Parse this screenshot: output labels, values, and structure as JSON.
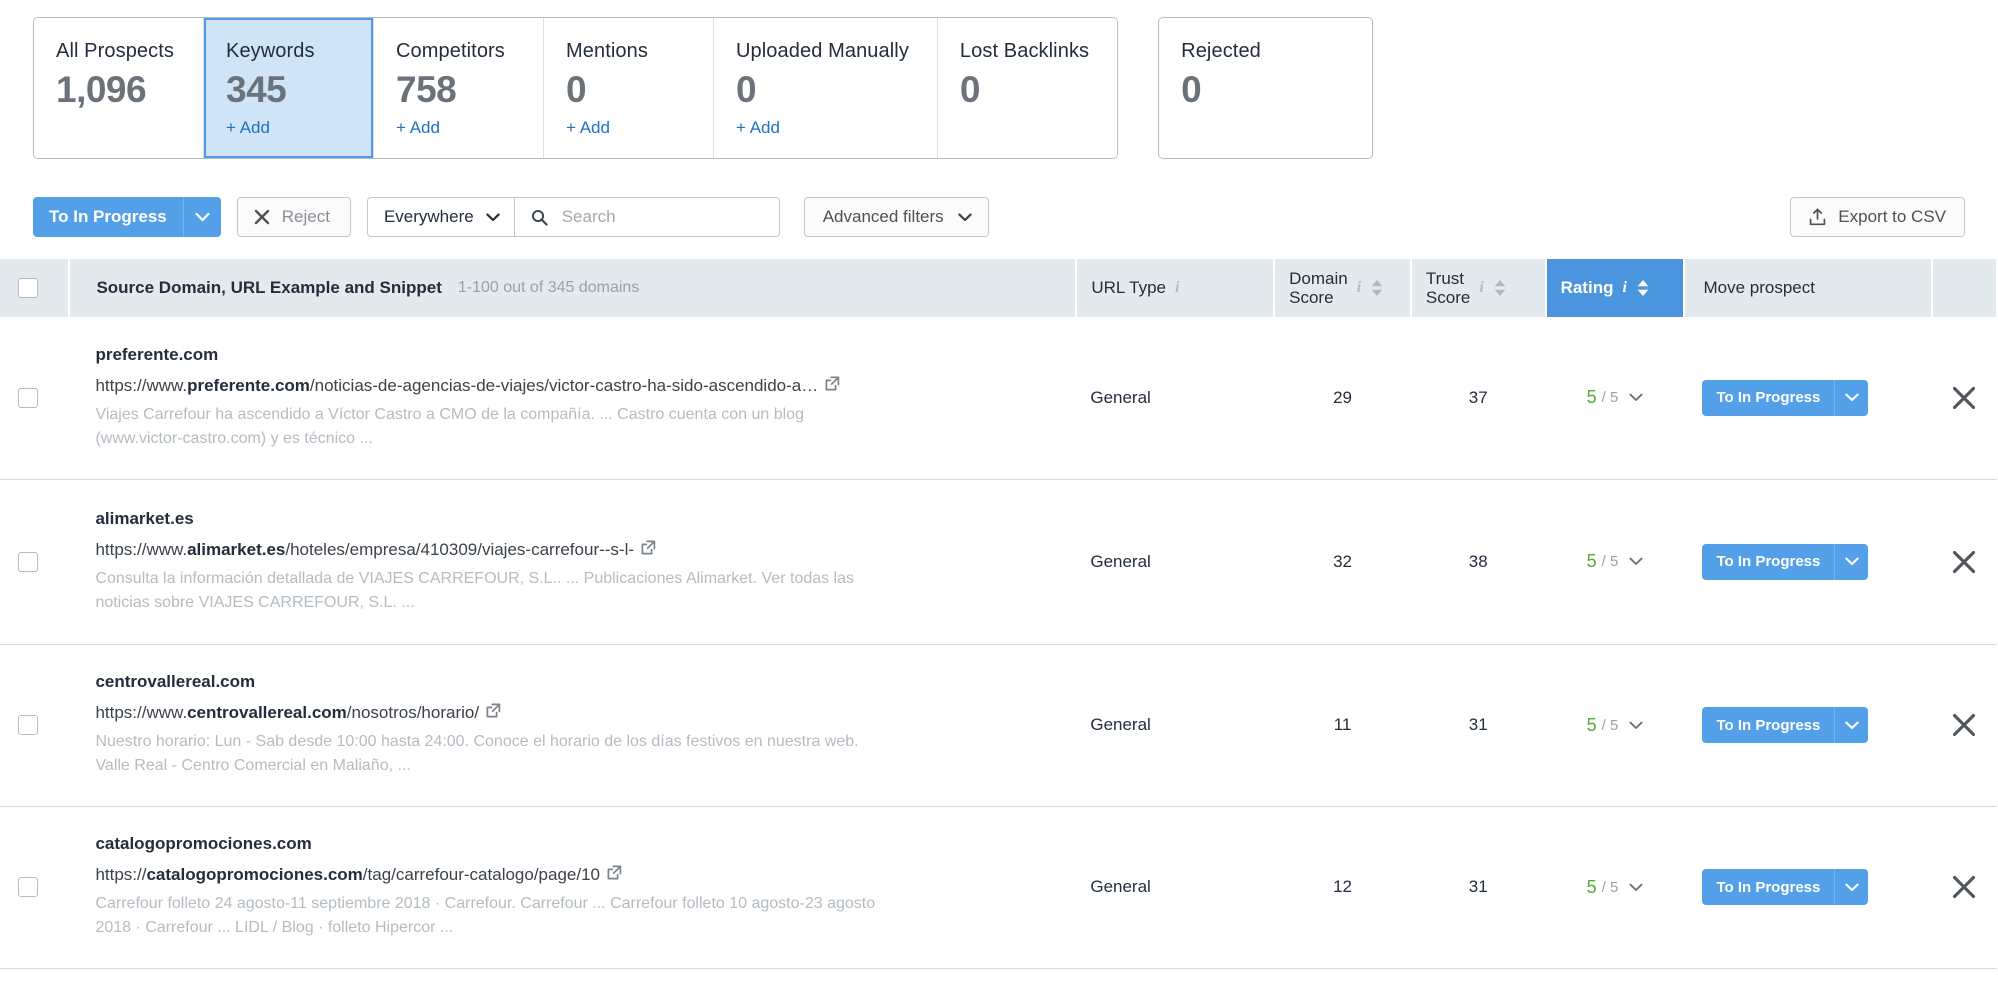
{
  "tabs": {
    "group": [
      {
        "label": "All Prospects",
        "count": "1,096",
        "add": null,
        "active": false
      },
      {
        "label": "Keywords",
        "count": "345",
        "add": "+ Add",
        "active": true
      },
      {
        "label": "Competitors",
        "count": "758",
        "add": "+ Add",
        "active": false
      },
      {
        "label": "Mentions",
        "count": "0",
        "add": "+ Add",
        "active": false
      },
      {
        "label": "Uploaded Manually",
        "count": "0",
        "add": "+ Add",
        "active": false
      },
      {
        "label": "Lost Backlinks",
        "count": "0",
        "add": null,
        "active": false
      }
    ],
    "standalone": {
      "label": "Rejected",
      "count": "0"
    }
  },
  "toolbar": {
    "to_in_progress_label": "To In Progress",
    "reject_label": "Reject",
    "scope_label": "Everywhere",
    "search_placeholder": "Search",
    "search_value": "",
    "advanced_filters_label": "Advanced filters",
    "export_label": "Export to CSV"
  },
  "table": {
    "headers": {
      "source_title": "Source Domain, URL Example and Snippet",
      "source_sub": "1-100 out of 345 domains",
      "url_type": "URL Type",
      "domain_score_l1": "Domain",
      "domain_score_l2": "Score",
      "trust_score_l1": "Trust",
      "trust_score_l2": "Score",
      "rating": "Rating",
      "move_prospect": "Move prospect"
    },
    "rows": [
      {
        "domain": "preferente.com",
        "url_prefix": "https://www.",
        "url_bold": "preferente.com",
        "url_rest": "/noticias-de-agencias-de-viajes/victor-castro-ha-sido-ascendido-a…",
        "snippet": "Viajes Carrefour ha ascendido a Víctor Castro a CMO de la compañía. ... Castro cuenta con un blog (www.victor-castro.com) y es técnico ...",
        "url_type": "General",
        "domain_score": "29",
        "trust_score": "37",
        "rating_value": "5",
        "rating_max": "/ 5",
        "move_label": "To In Progress"
      },
      {
        "domain": "alimarket.es",
        "url_prefix": "https://www.",
        "url_bold": "alimarket.es",
        "url_rest": "/hoteles/empresa/410309/viajes-carrefour--s-l-",
        "snippet": "Consulta la información detallada de VIAJES CARREFOUR, S.L.. ... Publicaciones Alimarket. Ver todas las noticias sobre VIAJES CARREFOUR, S.L. ...",
        "url_type": "General",
        "domain_score": "32",
        "trust_score": "38",
        "rating_value": "5",
        "rating_max": "/ 5",
        "move_label": "To In Progress"
      },
      {
        "domain": "centrovallereal.com",
        "url_prefix": "https://www.",
        "url_bold": "centrovallereal.com",
        "url_rest": "/nosotros/horario/",
        "snippet": "Nuestro horario: Lun - Sab desde 10:00 hasta 24:00. Conoce el horario de los días festivos en nuestra web. Valle Real - Centro Comercial en Maliaño, ...",
        "url_type": "General",
        "domain_score": "11",
        "trust_score": "31",
        "rating_value": "5",
        "rating_max": "/ 5",
        "move_label": "To In Progress"
      },
      {
        "domain": "catalogopromociones.com",
        "url_prefix": "https://",
        "url_bold": "catalogopromociones.com",
        "url_rest": "/tag/carrefour-catalogo/page/10",
        "snippet": "Carrefour folleto 24 agosto-11 septiembre 2018 · Carrefour. Carrefour ... Carrefour folleto 10 agosto-23 agosto 2018 · Carrefour ... LIDL / Blog · folleto Hipercor ...",
        "url_type": "General",
        "domain_score": "12",
        "trust_score": "31",
        "rating_value": "5",
        "rating_max": "/ 5",
        "move_label": "To In Progress"
      }
    ]
  },
  "colors": {
    "accent_blue": "#53a0e8",
    "header_blue": "#4a95dd",
    "tab_active_bg": "#cfe4f7",
    "rating_green": "#56a93c",
    "link_blue": "#1f71c1",
    "header_bg": "#e3eaee"
  }
}
